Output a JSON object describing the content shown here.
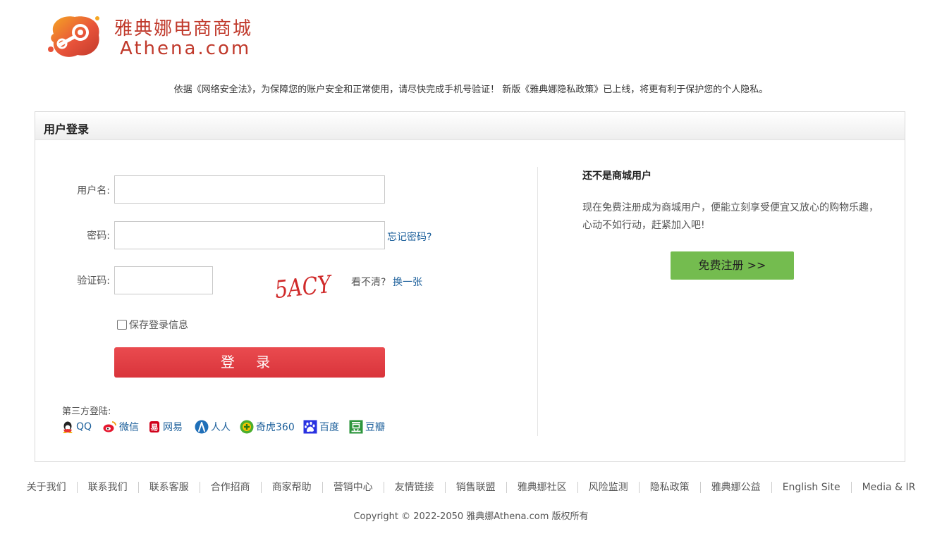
{
  "brand": {
    "name_cn": "雅典娜电商商城",
    "name_en": "Athena.com"
  },
  "notice": "依据《网络安全法》，为保障您的账户安全和正常使用，请尽快完成手机号验证！ 新版《雅典娜隐私政策》已上线，将更有利于保护您的个人隐私。",
  "login": {
    "title": "用户登录",
    "username_label": "用户名:",
    "username_value": "",
    "password_label": "密码:",
    "password_value": "",
    "forgot_password": "忘记密码?",
    "captcha_label": "验证码:",
    "captcha_value": "",
    "captcha_text": "5ACY",
    "captcha_unclear": "看不清?",
    "captcha_refresh": "换一张",
    "remember_label": "保存登录信息",
    "remember_checked": false,
    "submit_label": "登 录",
    "third_party_label": "第三方登陆:",
    "third_party": [
      {
        "label": "QQ",
        "icon": "qq-icon"
      },
      {
        "label": "微信",
        "icon": "weibo-icon"
      },
      {
        "label": "网易",
        "icon": "netease-icon"
      },
      {
        "label": "人人",
        "icon": "renren-icon"
      },
      {
        "label": "奇虎360",
        "icon": "qihoo360-icon"
      },
      {
        "label": "百度",
        "icon": "baidu-icon"
      },
      {
        "label": "豆瓣",
        "icon": "douban-icon"
      }
    ]
  },
  "register": {
    "title": "还不是商城用户",
    "description": "现在免费注册成为商城用户，便能立刻享受便宜又放心的购物乐趣，心动不如行动，赶紧加入吧!",
    "button": "免费注册 >>"
  },
  "footer": {
    "links": [
      "关于我们",
      "联系我们",
      "联系客服",
      "合作招商",
      "商家帮助",
      "营销中心",
      "友情链接",
      "销售联盟",
      "雅典娜社区",
      "风险监测",
      "隐私政策",
      "雅典娜公益",
      "English Site",
      "Media & IR"
    ],
    "copyright": "Copyright © 2022-2050 雅典娜Athena.com 版权所有"
  },
  "colors": {
    "brand_red": "#c0392b",
    "login_button": "#e0393e",
    "register_button": "#74bc4f",
    "link": "#1a5e9a"
  }
}
